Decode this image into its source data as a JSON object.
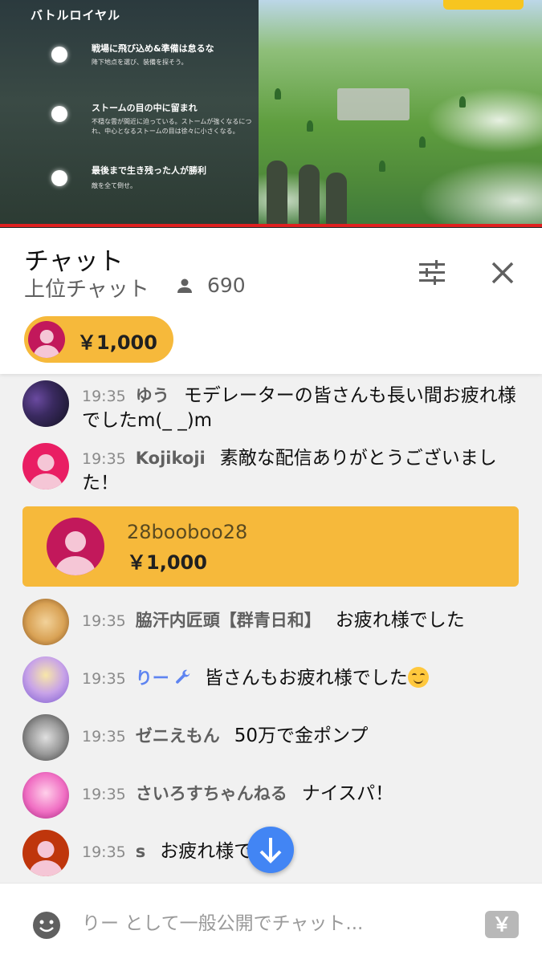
{
  "video": {
    "title": "バトルロイヤル",
    "steps": [
      {
        "heading": "戦場に飛び込め&準備は怠るな",
        "sub": "降下地点を選び、装備を探そう。"
      },
      {
        "heading": "ストームの目の中に留まれ",
        "sub": "不穏な雲が間近に迫っている。ストームが強くなるにつれ、中心となるストームの目は徐々に小さくなる。"
      },
      {
        "heading": "最後まで生き残った人が勝利",
        "sub": "敵を全て倒せ。"
      }
    ]
  },
  "header": {
    "title": "チャット",
    "mode": "上位チャット",
    "viewer_count": "690",
    "filter_icon": "tune-icon",
    "close_icon": "close-icon"
  },
  "ticker": {
    "amount": "￥1,000"
  },
  "messages": [
    {
      "time": "19:35",
      "author": "ゆう",
      "text": "モデレーターの皆さんも長い間お疲れ様でしたm(_ _)m"
    },
    {
      "time": "19:35",
      "author": "Kojikoji",
      "text": "素敵な配信ありがとうございました！"
    }
  ],
  "superchat": {
    "name": "28booboo28",
    "amount": "￥1,000"
  },
  "messages2": [
    {
      "time": "19:35",
      "author": "脇汗内匠頭【群青日和】",
      "text": "お疲れ様でした"
    },
    {
      "time": "19:35",
      "author": "りー",
      "text": "皆さんもお疲れ様でした"
    },
    {
      "time": "19:35",
      "author": "ゼニえもん",
      "text": "50万で金ポンプ"
    },
    {
      "time": "19:35",
      "author": "さいろすちゃんねる",
      "text": "ナイスパ！"
    },
    {
      "time": "19:35",
      "author": "s",
      "text": "お疲れ様でした"
    }
  ],
  "footer": {
    "placeholder": "りー として一般公開でチャット...",
    "yen_label": "￥"
  },
  "colors": {
    "superchat": "#f6b93b",
    "moderator": "#5e84f1",
    "scroll_button": "#4285f4"
  }
}
